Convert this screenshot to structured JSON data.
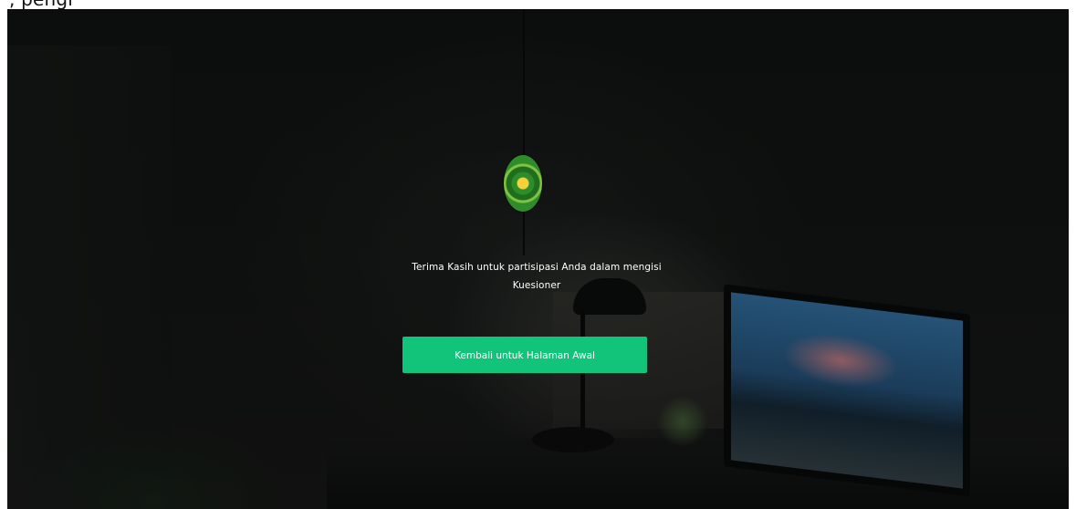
{
  "header": {
    "clipped_text": ", pengi"
  },
  "logo": {
    "icon": "court-seal-icon",
    "colors": {
      "outer_ring": "#2f8c2a",
      "center": "#f4d23b"
    }
  },
  "message": {
    "text": "Terima Kasih untuk partisipasi Anda dalam mengisi Kuesioner"
  },
  "actions": {
    "back_label": "Kembali untuk Halaman Awal",
    "back_color": "#12c47a"
  }
}
